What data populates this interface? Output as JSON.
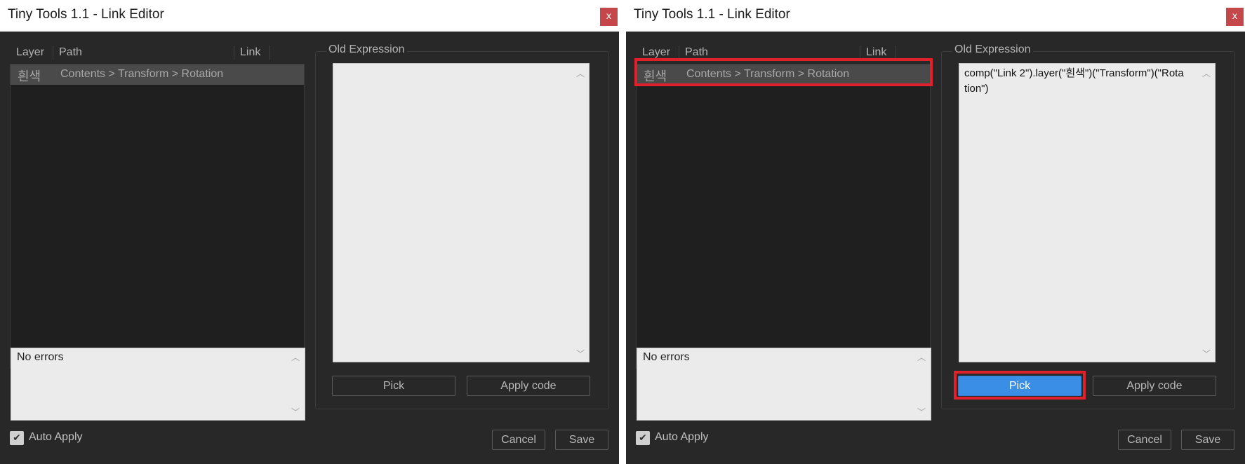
{
  "title": "Tiny Tools 1.1 - Link Editor",
  "close_label": "x",
  "headers": {
    "layer": "Layer",
    "path": "Path",
    "link": "Link"
  },
  "row": {
    "layer": "흰색",
    "path": "Contents > Transform > Rotation"
  },
  "errors_text": "No errors",
  "old_expression_label": "Old Expression",
  "expression_text_right": "comp(\"Link 2\").layer(\"흰색\")(\"Transform\")(\"Rotation\")",
  "buttons": {
    "pick": "Pick",
    "apply_code": "Apply code",
    "cancel": "Cancel",
    "save": "Save"
  },
  "auto_apply": {
    "label": "Auto Apply",
    "checked": true,
    "check_glyph": "✔"
  },
  "scroll_glyphs": {
    "up": "︿",
    "down": "﹀"
  },
  "colors": {
    "panel_bg": "#282828",
    "pick_active": "#3a8ee6",
    "highlight": "#e0202a",
    "close_bg": "#c4474a"
  }
}
